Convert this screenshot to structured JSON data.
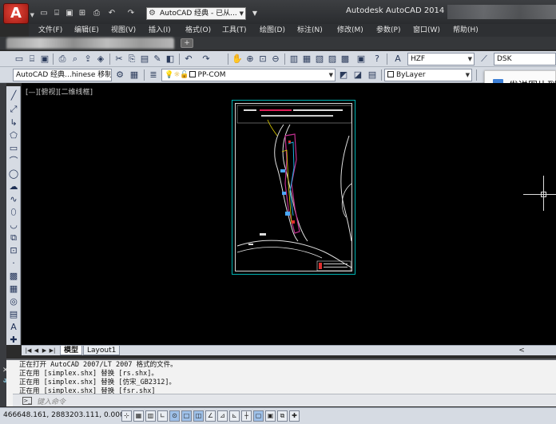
{
  "app": {
    "window_title": "Autodesk AutoCAD 2014",
    "app_button_letter": "A",
    "workspace": "AutoCAD 经典 - 已从...",
    "quick_access_icons": [
      "new-icon",
      "open-icon",
      "save-icon",
      "saveas-icon",
      "print-icon",
      "undo-icon",
      "redo-icon"
    ]
  },
  "menu": [
    "文件(F)",
    "编辑(E)",
    "视图(V)",
    "插入(I)",
    "格式(O)",
    "工具(T)",
    "绘图(D)",
    "标注(N)",
    "修改(M)",
    "参数(P)",
    "窗口(W)",
    "帮助(H)"
  ],
  "tabs": {
    "new_tab_label": "+"
  },
  "toolbar1": {
    "text_style": "HZF",
    "dim_style": "DSK"
  },
  "toolbar2": {
    "workspace_combo": "AutoCAD 经典...hinese 移制",
    "layer": "PP-COM",
    "color": "ByLayer"
  },
  "popup": {
    "label": "发送图片到"
  },
  "drawing": {
    "view_label": "[—][俯视][二维线框]"
  },
  "layout_tabs": [
    "模型",
    "Layout1"
  ],
  "command": {
    "history": [
      "正在打开 AutoCAD 2007/LT 2007 格式的文件。",
      "正在用 [simplex.shx] 替换 [rs.shx]。",
      "正在用 [simplex.shx] 替换 [仿宋_GB2312]。",
      "正在用 [simplex.shx] 替换 [fsr.shx]"
    ],
    "placeholder": "键入命令"
  },
  "status": {
    "coordinates": "466648.161, 2883203.111, 0.000"
  },
  "colors": {
    "drawing_bg": "#000000",
    "sheet_border": "#00b4b4",
    "toolbar_bg": "#d6dbe3",
    "title_bg": "#2a2c2f"
  }
}
